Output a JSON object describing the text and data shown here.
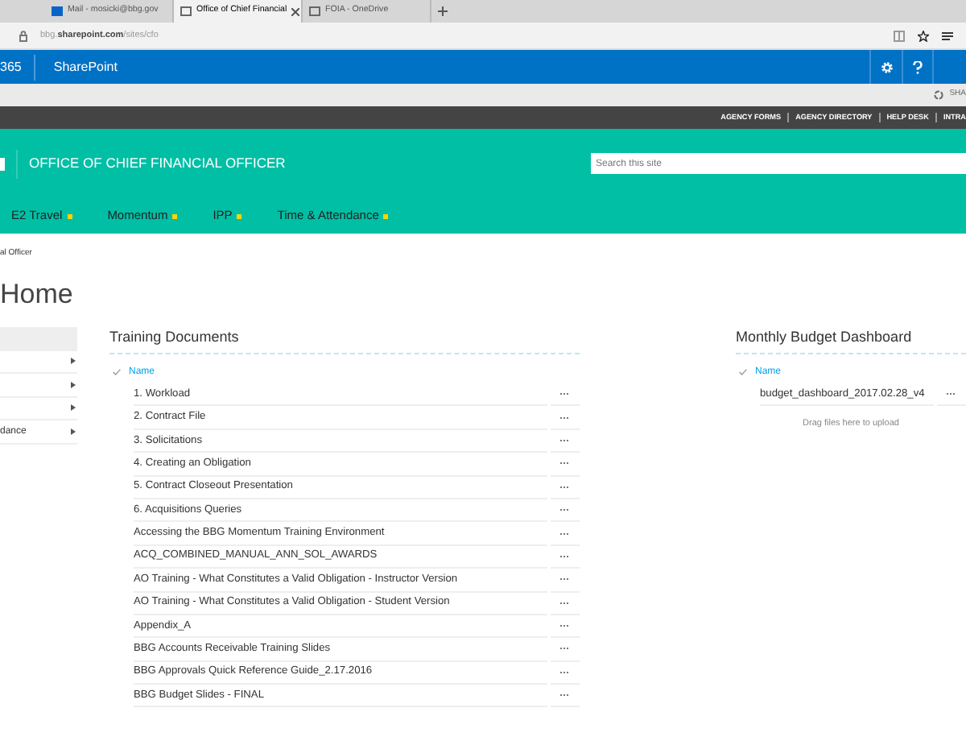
{
  "browser": {
    "tabs": [
      {
        "title": "Mail - mosicki@bbg.gov",
        "selected": false
      },
      {
        "title": "Office of Chief Financial",
        "selected": true
      },
      {
        "title": "FOIA - OneDrive",
        "selected": false
      }
    ],
    "address": {
      "pre": "bbg.",
      "domain": "sharepoint.com",
      "path": "/sites/cfo"
    }
  },
  "suite_bar": {
    "app_prefix": "365",
    "app": "SharePoint"
  },
  "share": "SHA",
  "top_links": [
    "AGENCY FORMS",
    "AGENCY DIRECTORY",
    "HELP DESK",
    "INTRA"
  ],
  "site": {
    "title": "OFFICE OF CHIEF FINANCIAL OFFICER",
    "search": {
      "placeholder": "Search this site"
    }
  },
  "nav": [
    "E2 Travel",
    "Momentum",
    "IPP",
    "Time & Attendance"
  ],
  "breadcrumb": "al Officer",
  "page_title": "Home",
  "sidebar": {
    "items": [
      {
        "kind": "header"
      },
      {
        "kind": "item"
      },
      {
        "kind": "item"
      },
      {
        "kind": "item"
      },
      {
        "kind": "item",
        "label": "dance"
      }
    ]
  },
  "training": {
    "title": "Training Documents",
    "column": "Name",
    "rows": [
      "1. Workload",
      "2. Contract File",
      "3. Solicitations",
      "4. Creating an Obligation",
      "5. Contract Closeout Presentation",
      "6. Acquisitions Queries",
      "Accessing the BBG Momentum Training Environment",
      "ACQ_COMBINED_MANUAL_ANN_SOL_AWARDS",
      "AO Training - What Constitutes a Valid Obligation - Instructor Version",
      "AO Training - What Constitutes a Valid Obligation - Student Version",
      "Appendix_A",
      "BBG Accounts Receivable Training Slides",
      "BBG Approvals Quick Reference Guide_2.17.2016",
      "BBG Budget Slides - FINAL"
    ]
  },
  "budget": {
    "title": "Monthly Budget Dashboard",
    "column": "Name",
    "rows": [
      "budget_dashboard_2017.02.28_v4"
    ],
    "drop_hint": "Drag files here to upload"
  }
}
